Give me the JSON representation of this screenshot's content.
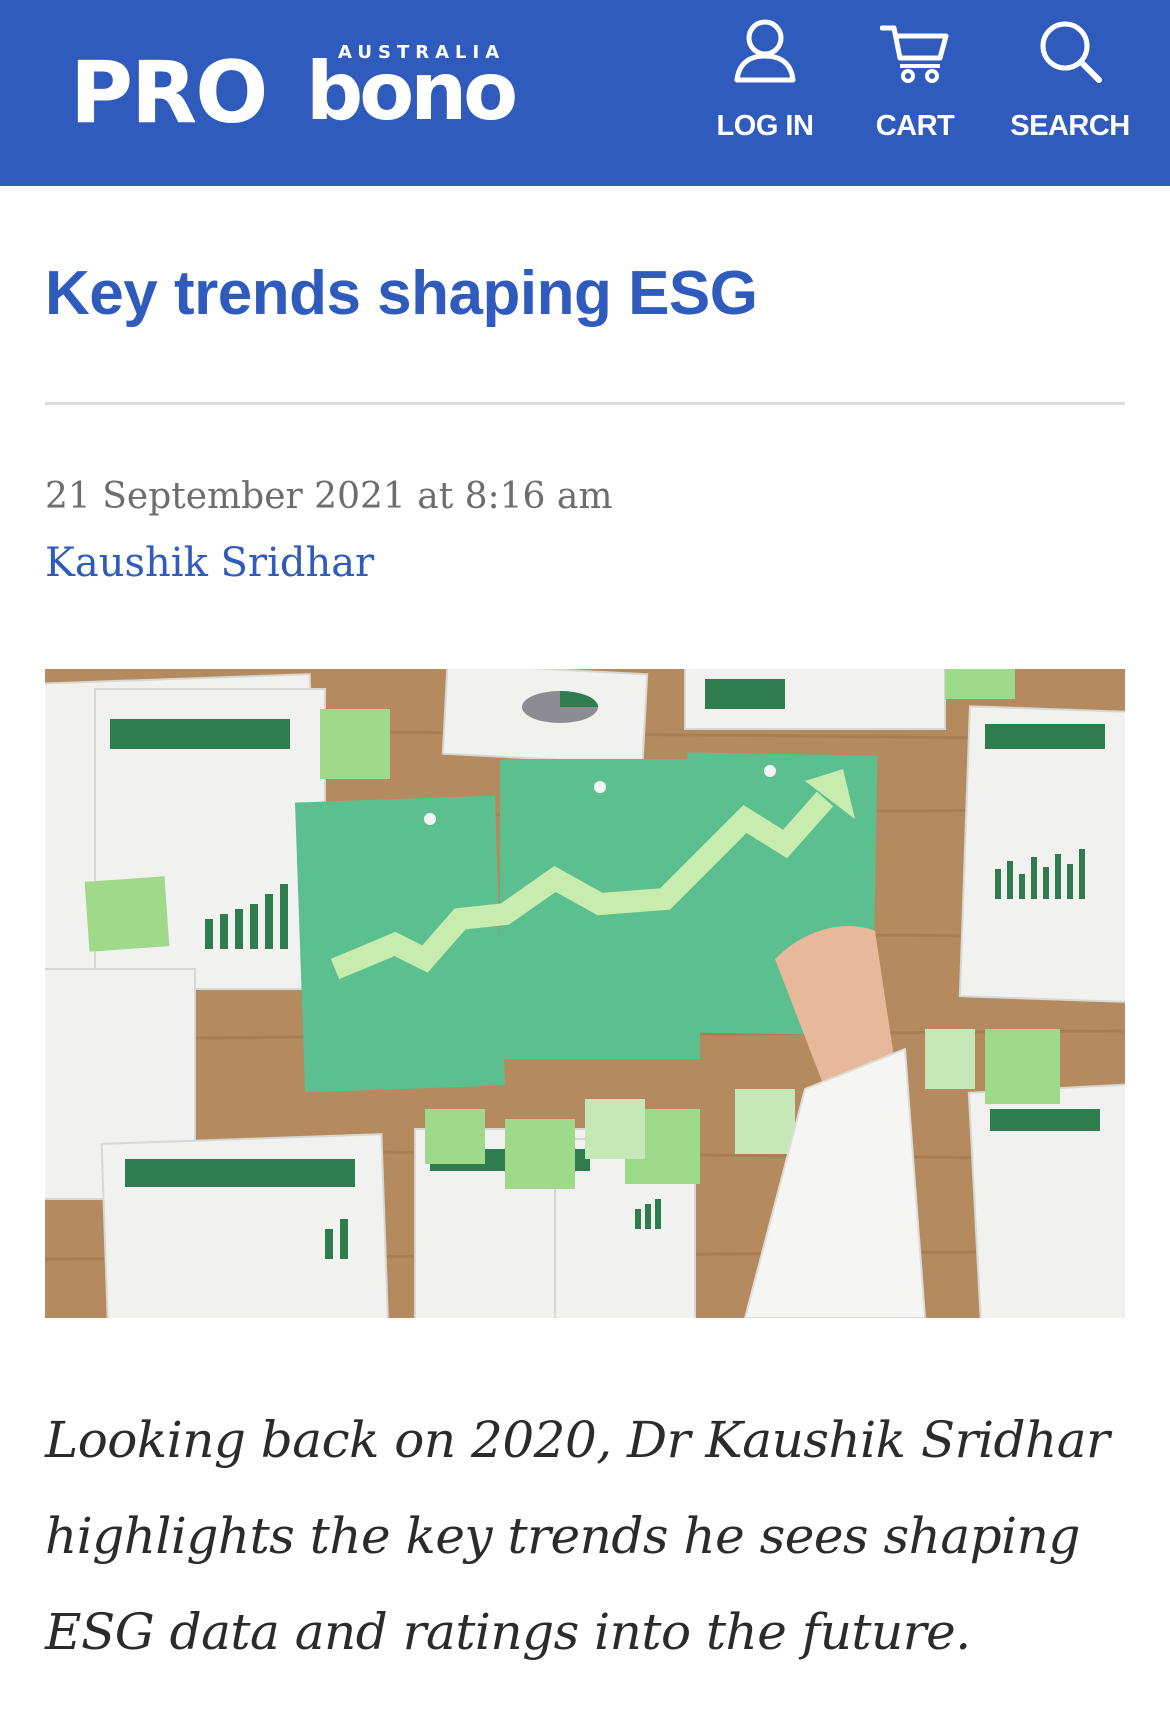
{
  "header": {
    "logo": {
      "main": "PRO",
      "secondary": "bono",
      "tagline": "AUSTRALIA"
    },
    "nav": [
      {
        "label": "LOG IN",
        "icon": "user-icon"
      },
      {
        "label": "CART",
        "icon": "cart-icon"
      },
      {
        "label": "SEARCH",
        "icon": "search-icon"
      }
    ]
  },
  "article": {
    "title": "Key trends shaping ESG",
    "date": "21 September 2021 at 8:16 am",
    "author": "Kaushik Sridhar",
    "lead": "Looking back on 2020, Dr Kaushik Sridhar highlights the key trends he sees shaping ESG data and ratings into the future."
  },
  "colors": {
    "brand_blue": "#2f5bbd",
    "meta_gray": "#6d6d6d",
    "divider": "#dcdcdc"
  }
}
